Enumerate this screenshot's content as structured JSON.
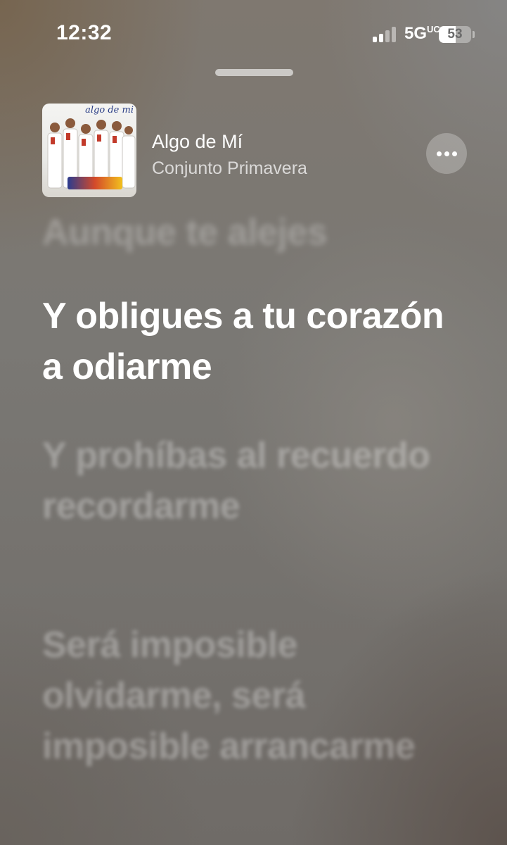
{
  "status_bar": {
    "time": "12:32",
    "network": "5G",
    "network_suffix": "UC",
    "battery_level": "53",
    "battery_fraction": 0.53
  },
  "now_playing": {
    "album_art_text": "algo de mi",
    "song_title": "Algo de Mí",
    "artist": "Conjunto Primavera"
  },
  "lyrics": {
    "previous": "Aunque te alejes",
    "current": "Y obligues a tu corazón a odiarme",
    "next": [
      "Y prohíbas al recuerdo recordarme",
      "Será imposible olvidarme, será imposible arrancarme"
    ]
  },
  "icons": {
    "more": "ellipsis-icon",
    "signal": "cellular-signal-icon",
    "battery": "battery-icon"
  }
}
